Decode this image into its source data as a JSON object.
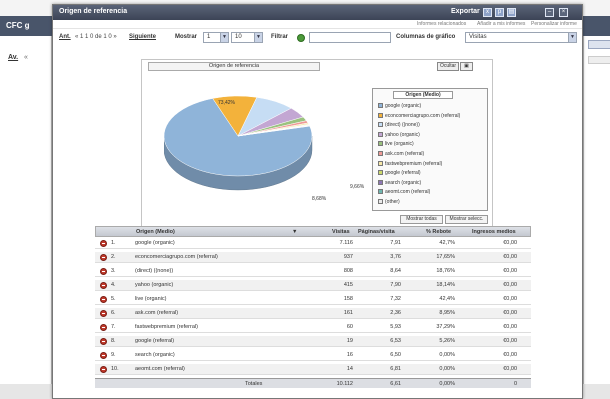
{
  "bg": {
    "left_head": "CFC g",
    "left_link": "Av.",
    "left_link2": "«"
  },
  "window": {
    "title": "Origen de referencia",
    "title_right": "Exportar",
    "icons": [
      "export-excel-icon",
      "export-pdf-icon",
      "print-icon",
      "minimize-icon",
      "close-icon"
    ],
    "subbar": [
      "Informes relacionados",
      "Añadir a mis informes",
      "Personalizar informe"
    ]
  },
  "toolbar": {
    "prev_label": "Ant.",
    "pagination": "« 1 1 0 de 1 0 »",
    "next_label": "Siguiente",
    "show_label": "Mostrar",
    "show_from": "1",
    "show_count": "10",
    "filter_label": "Filtrar",
    "columns_label": "Columnas de gráfico",
    "columns_value": "Visitas"
  },
  "chart": {
    "title": "Origen de referencia",
    "btn_label": "Ocultar",
    "legend_title": "Origen (Medio)",
    "btn_all": "Mostrar todas",
    "btn_selected": "Mostrar selecc.",
    "label_big": "73,42%",
    "label_a": "9,66%",
    "label_b": "8,68%"
  },
  "chart_data": {
    "type": "pie",
    "title": "Origen de referencia",
    "categories": [
      "google (organic)",
      "econcomerciagrupo.com (referral)",
      "(direct) ((none))",
      "yahoo (organic)",
      "live (organic)",
      "ask.com (referral)",
      "fastwebpremium (referral)",
      "google (referral)",
      "search (organic)",
      "aeomt.com (referral)",
      "(other)"
    ],
    "values": [
      73.42,
      9.66,
      8.68,
      4.35,
      1.62,
      0.96,
      0.58,
      0.2,
      0.17,
      0.14,
      0.22
    ],
    "colors": [
      "#8fb4d9",
      "#f3b23b",
      "#c6ddf4",
      "#c3a7d3",
      "#9bc27f",
      "#ef9b97",
      "#f6e7a8",
      "#cbd86a",
      "#8e77b5",
      "#6fb7b0",
      "#e9e9e9"
    ]
  },
  "table": {
    "headers": {
      "origin": "Origen (Medio)",
      "visits": "Visitas",
      "pages": "Páginas/visita",
      "time": "% Rebote",
      "new": "Ingresos medios"
    },
    "rows": [
      {
        "n": "1.",
        "name": "google (organic)",
        "visits": "7.116",
        "pages": "7,91",
        "pct": "42,7%",
        "rev": "€0,00"
      },
      {
        "n": "2.",
        "name": "econcomerciagrupo.com (referral)",
        "visits": "937",
        "pages": "3,76",
        "pct": "17,65%",
        "rev": "€0,00"
      },
      {
        "n": "3.",
        "name": "(direct) ((none))",
        "visits": "808",
        "pages": "8,64",
        "pct": "18,76%",
        "rev": "€0,00"
      },
      {
        "n": "4.",
        "name": "yahoo (organic)",
        "visits": "415",
        "pages": "7,90",
        "pct": "18,14%",
        "rev": "€0,00"
      },
      {
        "n": "5.",
        "name": "live (organic)",
        "visits": "158",
        "pages": "7,32",
        "pct": "42,4%",
        "rev": "€0,00"
      },
      {
        "n": "6.",
        "name": "ask.com (referral)",
        "visits": "161",
        "pages": "2,36",
        "pct": "8,95%",
        "rev": "€0,00"
      },
      {
        "n": "7.",
        "name": "fastwebpremium (referral)",
        "visits": "60",
        "pages": "5,93",
        "pct": "37,29%",
        "rev": "€0,00"
      },
      {
        "n": "8.",
        "name": "google (referral)",
        "visits": "19",
        "pages": "6,53",
        "pct": "5,26%",
        "rev": "€0,00"
      },
      {
        "n": "9.",
        "name": "search (organic)",
        "visits": "16",
        "pages": "6,50",
        "pct": "0,00%",
        "rev": "€0,00"
      },
      {
        "n": "10.",
        "name": "aeomt.com (referral)",
        "visits": "14",
        "pages": "6,81",
        "pct": "0,00%",
        "rev": "€0,00"
      }
    ],
    "totals": {
      "label": "Totales",
      "visits": "10.112",
      "pages": "6,61",
      "pct": "0,00%",
      "rev": "0"
    }
  }
}
